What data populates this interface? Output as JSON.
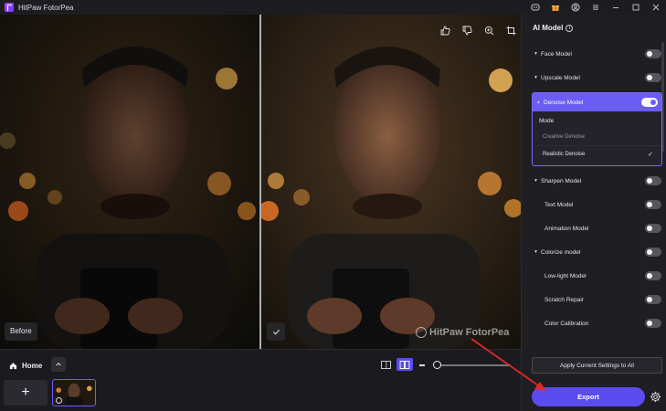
{
  "app": {
    "title": "HitPaw FotorPea"
  },
  "titlebar": {
    "icons": [
      "discord-icon",
      "gift-icon",
      "user-icon",
      "menu-icon",
      "minimize-icon",
      "maximize-icon",
      "close-icon"
    ]
  },
  "preview": {
    "before_label": "Before",
    "watermark": "HitPaw FotorPea",
    "tools": [
      "thumbs-up-icon",
      "thumbs-down-icon",
      "zoom-icon",
      "crop-icon"
    ]
  },
  "bottom": {
    "home_label": "Home",
    "add_label": "+"
  },
  "panel": {
    "title": "AI Model",
    "rows_top": [
      {
        "label": "Face Model",
        "caret": true,
        "on": false
      },
      {
        "label": "Upscale Model",
        "caret": true,
        "on": false
      }
    ],
    "denoise": {
      "label": "Denoise Model",
      "on": true,
      "mode_label": "Mode",
      "options": [
        "Creative Denoise",
        "Realistic Denoise"
      ],
      "selected": "Realistic Denoise"
    },
    "rows_bottom": [
      {
        "label": "Sharpen Model",
        "caret": true,
        "on": false
      },
      {
        "label": "Text Model",
        "caret": false,
        "on": false
      },
      {
        "label": "Animation Model",
        "caret": false,
        "on": false
      },
      {
        "label": "Colorize model",
        "caret": true,
        "on": false
      },
      {
        "label": "Low-light Model",
        "caret": false,
        "on": false
      },
      {
        "label": "Scratch Repair",
        "caret": false,
        "on": false
      },
      {
        "label": "Color Calibration",
        "caret": false,
        "on": false
      }
    ],
    "apply_label": "Apply Current Settings to All",
    "export_label": "Export"
  },
  "colors": {
    "accent": "#5b4cf0",
    "panel_bg": "#1e1e23",
    "annotation_arrow": "#e0282a"
  }
}
